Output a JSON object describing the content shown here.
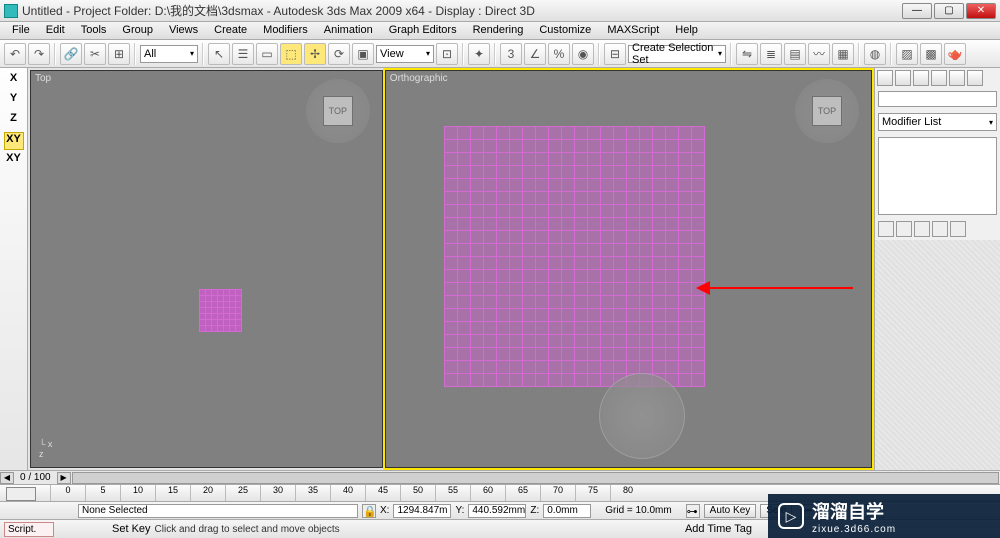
{
  "window": {
    "title": "Untitled     - Project Folder: D:\\我的文档\\3dsmax       - Autodesk 3ds Max  2009 x64        - Display : Direct 3D",
    "min": "—",
    "max": "▢",
    "close": "✕"
  },
  "menu": [
    "File",
    "Edit",
    "Tools",
    "Group",
    "Views",
    "Create",
    "Modifiers",
    "Animation",
    "Graph Editors",
    "Rendering",
    "Customize",
    "MAXScript",
    "Help"
  ],
  "toolbar": {
    "combo_all": "All",
    "combo_view": "View",
    "selection_set": "Create Selection Set"
  },
  "axes": [
    "X",
    "Y",
    "Z",
    "XY",
    "XY"
  ],
  "viewports": {
    "left_label": "Top",
    "right_label": "Orthographic",
    "cube_face": "TOP",
    "frame_readout": "0 / 100"
  },
  "command_panel": {
    "name_field": "",
    "modifier_combo": "Modifier List"
  },
  "ruler_ticks": [
    "0",
    "5",
    "10",
    "15",
    "20",
    "25",
    "30",
    "35",
    "40",
    "45",
    "50",
    "55",
    "60",
    "65",
    "70",
    "75",
    "80"
  ],
  "status": {
    "selection": "None Selected",
    "x": "1294.847m",
    "x_lbl": "X:",
    "y": "440.592mm",
    "y_lbl": "Y:",
    "z": "0.0mm",
    "z_lbl": "Z:",
    "grid": "Grid = 10.0mm",
    "autokey": "Auto Key",
    "sele": "Sele",
    "setkey": "Set Key",
    "timetag": "Add Time Tag",
    "script": "Script.",
    "hint": "Click and drag to select and move objects"
  },
  "watermark": {
    "cn": "溜溜自学",
    "url": "zixue.3d66.com"
  },
  "icons": {
    "undo": "↶",
    "redo": "↷",
    "link": "🔗",
    "unlink": "✂",
    "select": "↖",
    "rect": "▭",
    "win": "⬚",
    "cross": "✥",
    "move": "✢",
    "rotate": "⟳",
    "scale": "▣",
    "snap": "∟",
    "angle": "∠",
    "mirror": "⇋",
    "align": "≣",
    "layers": "▤",
    "schematic": "▦",
    "mat": "◍",
    "render": "🫖",
    "first": "⏮",
    "prev": "◀",
    "playbtn": "▶",
    "next": "▶",
    "last": "⏭",
    "key": "⊚",
    "lock": "🔒",
    "keyicon": "⊶"
  }
}
